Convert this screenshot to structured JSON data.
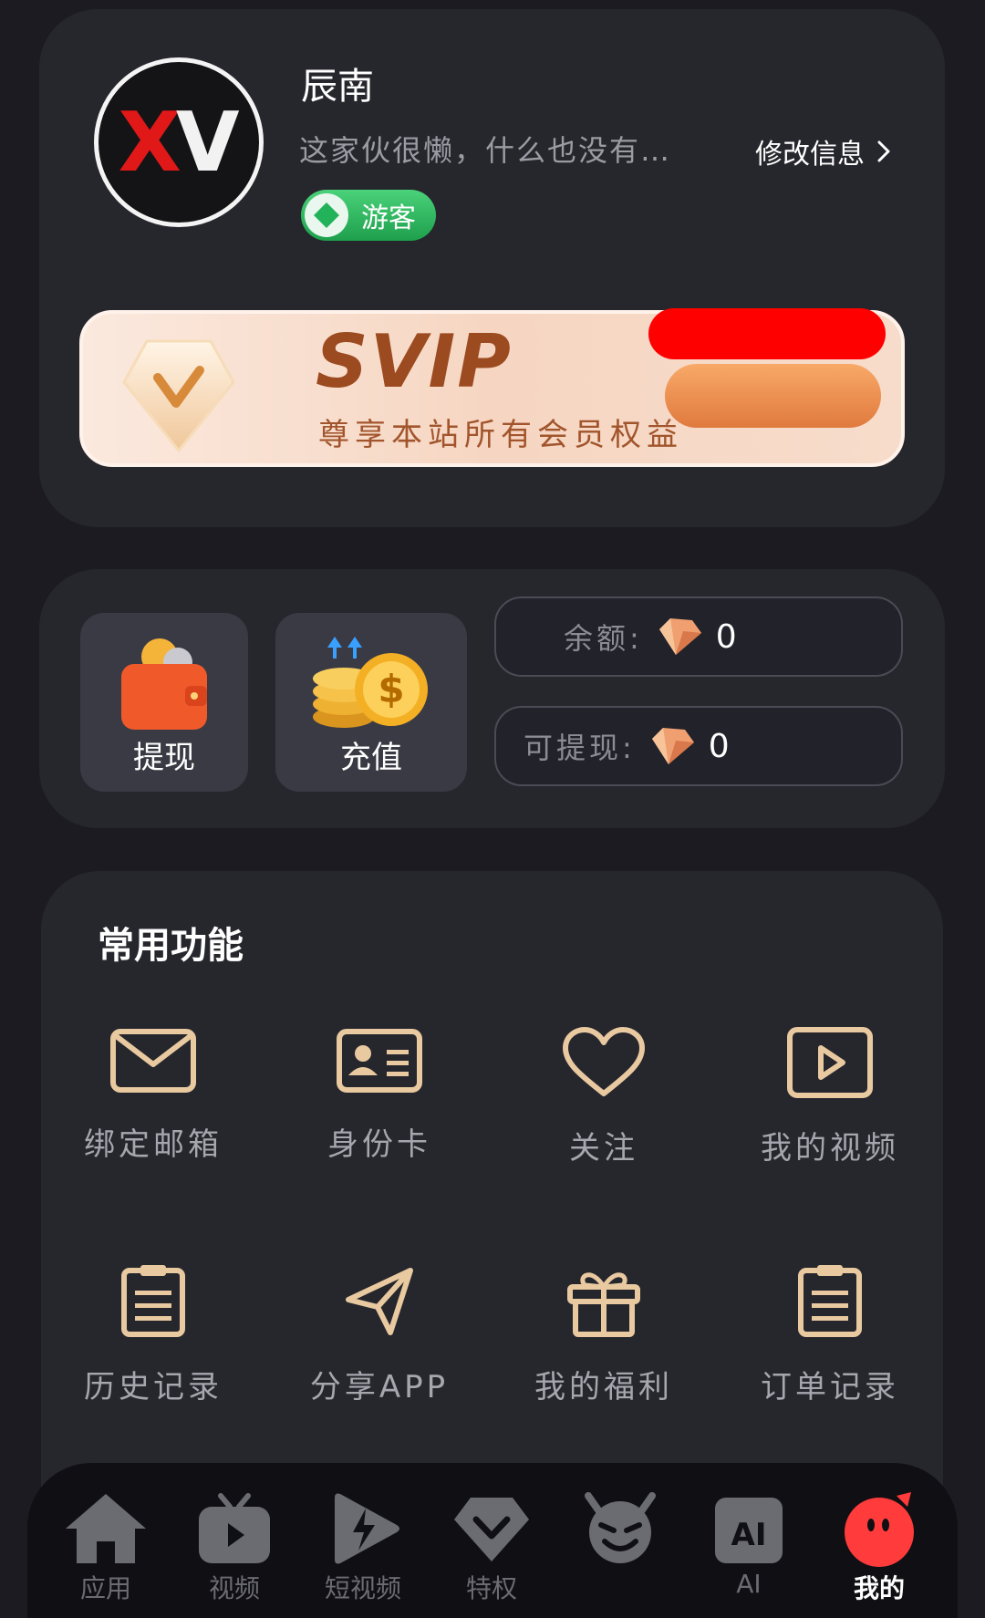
{
  "profile": {
    "avatar_text_1": "X",
    "avatar_text_2": "V",
    "username": "辰南",
    "bio": "这家伙很懒，什么也没有…",
    "edit_label": "修改信息",
    "badge": "游客"
  },
  "svip": {
    "title": "SVIP",
    "subtitle": "尊享本站所有会员权益"
  },
  "wallet": {
    "withdraw_label": "提现",
    "recharge_label": "充值",
    "balance_label": "余额:",
    "balance_value": "0",
    "withdrawable_label": "可提现:",
    "withdrawable_value": "0"
  },
  "functions": {
    "title": "常用功能",
    "items": [
      {
        "label": "绑定邮箱",
        "icon": "mail-icon"
      },
      {
        "label": "身份卡",
        "icon": "id-card-icon"
      },
      {
        "label": "关注",
        "icon": "heart-icon"
      },
      {
        "label": "我的视频",
        "icon": "video-play-icon"
      },
      {
        "label": "历史记录",
        "icon": "clipboard-icon"
      },
      {
        "label": "分享APP",
        "icon": "paper-plane-icon"
      },
      {
        "label": "我的福利",
        "icon": "gift-icon"
      },
      {
        "label": "订单记录",
        "icon": "clipboard-icon"
      }
    ]
  },
  "nav": {
    "items": [
      {
        "label": "应用",
        "icon": "home-icon"
      },
      {
        "label": "视频",
        "icon": "tv-icon"
      },
      {
        "label": "短视频",
        "icon": "lightning-play-icon"
      },
      {
        "label": "特权",
        "icon": "diamond-icon"
      },
      {
        "label": "",
        "icon": "devil-face-icon"
      },
      {
        "label": "AI",
        "icon": "ai-icon"
      },
      {
        "label": "我的",
        "icon": "mine-face-icon"
      }
    ],
    "active": "我的"
  },
  "colors": {
    "background": "#1b1b21",
    "card": "#26262d",
    "accent_gold": "#e8c9a0",
    "guest_green": "#2fb45f",
    "active_red": "#ff3b3b"
  }
}
